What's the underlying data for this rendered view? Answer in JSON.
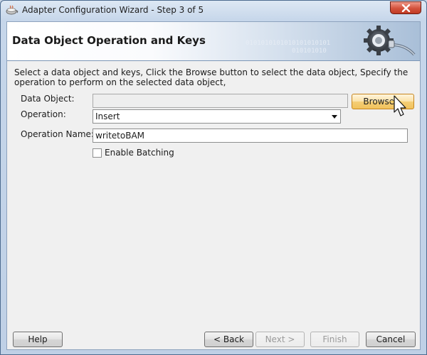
{
  "window": {
    "title": "Adapter Configuration Wizard - Step 3 of 5"
  },
  "banner": {
    "title": "Data Object Operation and Keys",
    "binary_line1": "0101010101010101010101",
    "binary_line2": "010101010"
  },
  "instructions": "Select a data object and keys,  Click the Browse button to select the data object,  Specify the operation to perform on the selected data object,",
  "form": {
    "data_object_label": "Data Object:",
    "data_object_value": "",
    "browse_label": "Browse...",
    "operation_label": "Operation:",
    "operation_value": "Insert",
    "operation_name_label": "Operation Name:",
    "operation_name_value": "writetoBAM",
    "enable_batching_label": "Enable Batching",
    "enable_batching_checked": false
  },
  "footer": {
    "help_label": "Help",
    "back_label": "< Back",
    "next_label": "Next >",
    "finish_label": "Finish",
    "cancel_label": "Cancel"
  }
}
